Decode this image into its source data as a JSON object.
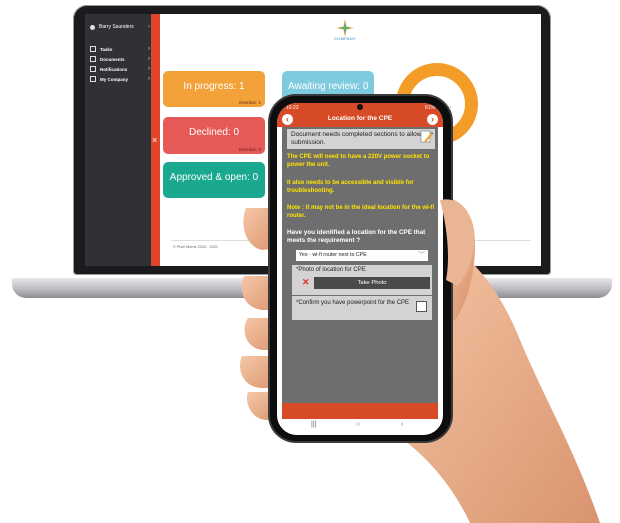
{
  "desktop": {
    "user_name": "Barry Saunders",
    "nav": [
      {
        "label": "Tasks",
        "icon": "tasks-icon"
      },
      {
        "label": "Documents",
        "icon": "documents-icon"
      },
      {
        "label": "Notifications",
        "icon": "bell-icon"
      },
      {
        "label": "My Company",
        "icon": "company-icon"
      }
    ],
    "logo_text": "COMPANY",
    "close_symbol": "×",
    "cards": {
      "in_progress": {
        "label": "In progress: 1",
        "sub": "Overdue: 1"
      },
      "awaiting": {
        "label": "Awaiting review: 0"
      },
      "declined": {
        "label": "Declined: 0",
        "sub": "Overdue: 0"
      },
      "approved": {
        "label": "Approved & open: 0"
      }
    },
    "tasks_label": "sks:",
    "footer": "© Pixel Meme 2020 - 2021"
  },
  "phone": {
    "time": "10:23",
    "battery": "61%",
    "title": "Location for the CPE",
    "back_symbol": "‹",
    "next_symbol": "›",
    "notice": "Document needs completed sections to allow submission.",
    "yellow_1": "The CPE will need to have a 220V power socket to power the unit.",
    "yellow_2": "It also needs to be accessible and visible for troubleshooting.",
    "yellow_3": "Note : It may not be in the ideal location for the wi-fi router.",
    "question": "Have you identified a location for the CPE that meets the requirement ?",
    "select_value": "Yes - wi-fi router next to CPE",
    "photo_label": "*Photo of location for CPE",
    "photo_x": "✕",
    "photo_button": "Take Photo",
    "confirm_label": "*Confirm you have powerpoint for the CPE",
    "android_nav": {
      "recent": "|||",
      "home": "○",
      "back": "‹"
    }
  },
  "colors": {
    "accent": "#d64a26",
    "in_progress": "#f3a23a",
    "awaiting": "#7ecbe0",
    "declined": "#e55a57",
    "approved": "#1aa98f",
    "warning_text": "#ffe300"
  }
}
